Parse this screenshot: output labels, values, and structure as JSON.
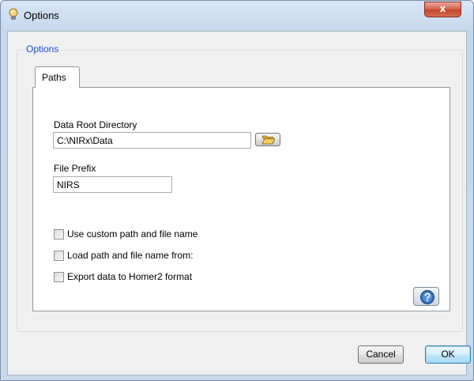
{
  "window": {
    "title": "Options",
    "close_label": "x"
  },
  "group": {
    "label": "Options"
  },
  "tabs": [
    {
      "label": "Paths",
      "selected": true
    }
  ],
  "paths": {
    "data_root_label": "Data Root Directory",
    "data_root_value": "C:\\NIRx\\Data",
    "file_prefix_label": "File Prefix",
    "file_prefix_value": "NIRS"
  },
  "options": [
    {
      "label": "Use custom path and file name",
      "checked": false
    },
    {
      "label": "Load path and file name from:",
      "checked": false
    },
    {
      "label": "Export data to Homer2 format",
      "checked": false
    }
  ],
  "footer": {
    "cancel_label": "Cancel",
    "ok_label": "OK"
  },
  "colors": {
    "group_label": "#1e4fd1",
    "title_bar": "#c6d8ee",
    "close_button": "#c2432b"
  },
  "icons": {
    "app": "lightbulb-icon",
    "browse": "folder-open-icon",
    "help": "help-icon"
  }
}
